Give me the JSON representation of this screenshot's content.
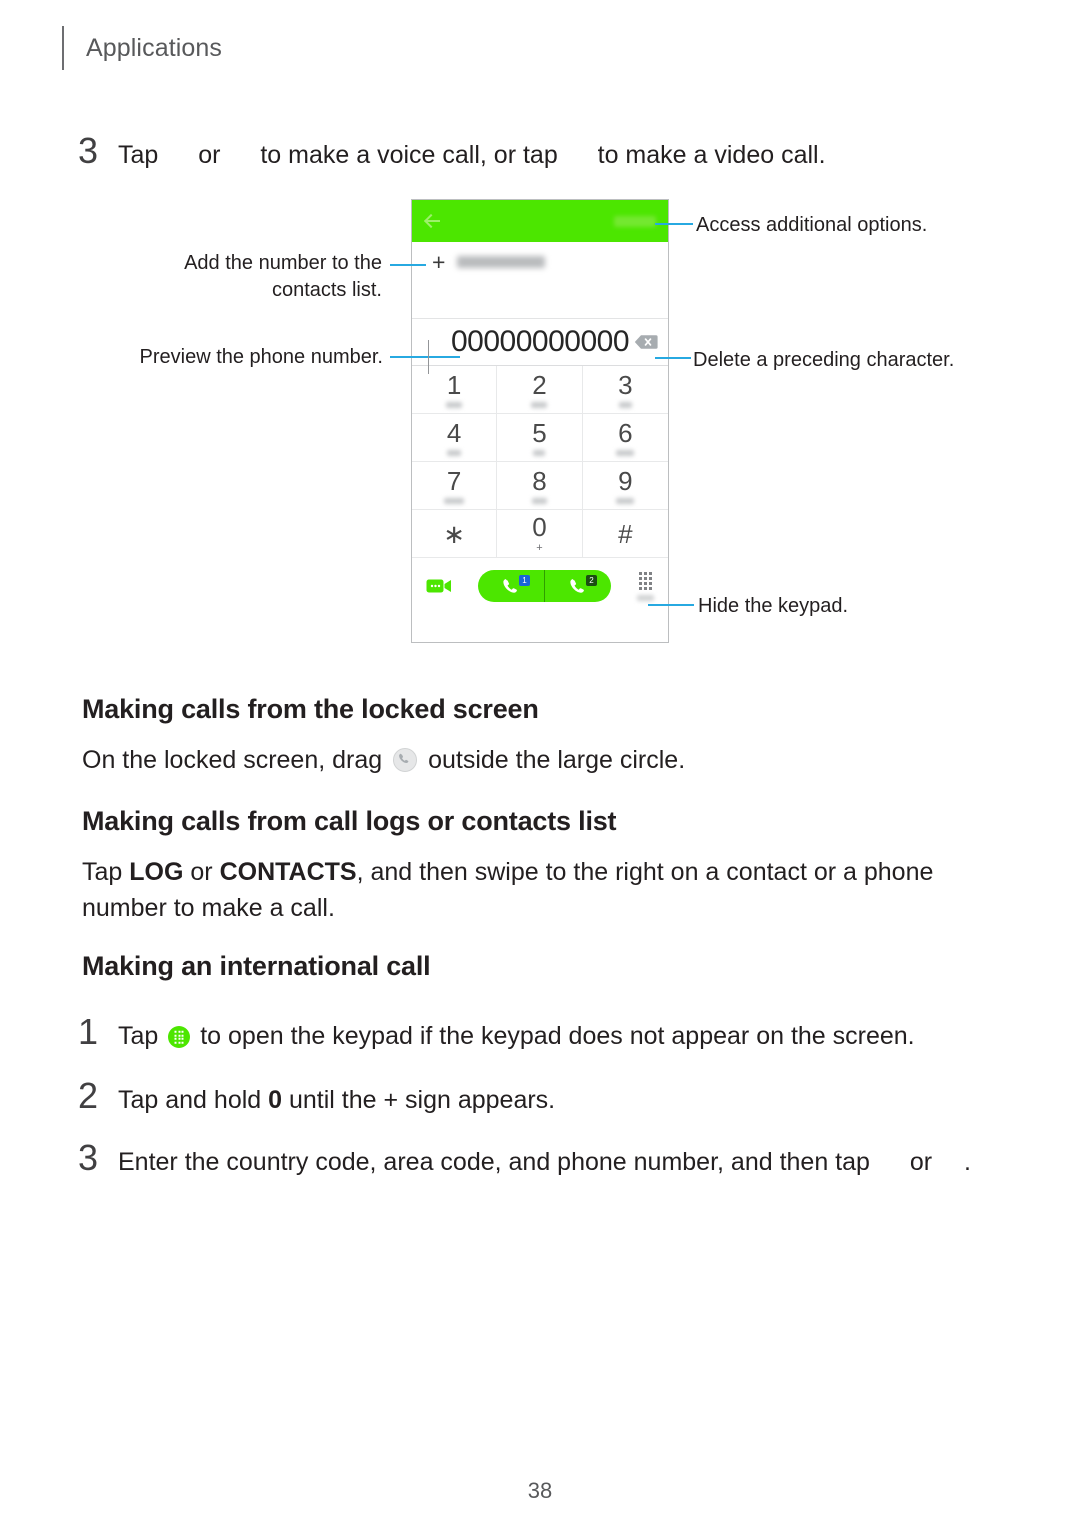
{
  "header": {
    "title": "Applications"
  },
  "steps": {
    "top": {
      "number": "3",
      "before_icons": "Tap",
      "between": "or",
      "after_first": "to make a voice call, or tap",
      "tail": "to make a video call."
    },
    "intl_1": {
      "number": "1",
      "pre": "Tap",
      "post": "to open the keypad if the keypad does not appear on the screen."
    },
    "intl_2": {
      "number": "2",
      "text_a": "Tap and hold ",
      "bold": "0",
      "text_b": " until the + sign appears."
    },
    "intl_3": {
      "number": "3",
      "pre": "Enter the country code, area code, and phone number, and then tap",
      "mid": "or",
      "post": "."
    }
  },
  "phone": {
    "topbar": {
      "back_icon": "back-arrow-icon",
      "more_label": ""
    },
    "add_contact": {
      "plus": "+",
      "label": ""
    },
    "number_preview": "00000000000",
    "keypad": [
      {
        "digit": "1",
        "sub": "",
        "sub_width": 16
      },
      {
        "digit": "2",
        "sub": "",
        "sub_width": 16
      },
      {
        "digit": "3",
        "sub": "",
        "sub_width": 13
      },
      {
        "digit": "4",
        "sub": "",
        "sub_width": 14
      },
      {
        "digit": "5",
        "sub": "",
        "sub_width": 12
      },
      {
        "digit": "6",
        "sub": "",
        "sub_width": 18
      },
      {
        "digit": "7",
        "sub": "",
        "sub_width": 20
      },
      {
        "digit": "8",
        "sub": "",
        "sub_width": 15
      },
      {
        "digit": "9",
        "sub": "",
        "sub_width": 18
      },
      {
        "digit": "∗",
        "sub": "",
        "sub_width": 0
      },
      {
        "digit": "0",
        "sub": "+",
        "sub_width": 0
      },
      {
        "digit": "#",
        "sub": "",
        "sub_width": 0
      }
    ],
    "actions": {
      "video_icon": "video-call-icon",
      "call_sim1_badge": "1",
      "call_sim2_badge": "2",
      "keypad_toggle_icon": "keypad-icon"
    }
  },
  "callouts": {
    "add_to_contacts": "Add the number to the contacts list.",
    "preview_number": "Preview the phone number.",
    "access_options": "Access additional options.",
    "delete_char": "Delete a preceding character.",
    "hide_keypad": "Hide the keypad."
  },
  "sections": {
    "locked": {
      "heading": "Making calls from the locked screen",
      "body_a": "On the locked screen, drag",
      "body_b": "outside the large circle."
    },
    "logs": {
      "heading": "Making calls from call logs or contacts list",
      "body_a": "Tap ",
      "bold_log": "LOG",
      "body_b": " or ",
      "bold_contacts": "CONTACTS",
      "body_c": ", and then swipe to the right on a contact or a phone number to make a call."
    },
    "international": {
      "heading": "Making an international call"
    }
  },
  "footer": {
    "page_number": "38"
  },
  "colors": {
    "accent_green": "#4ce600",
    "leader_blue": "#27a9e1",
    "sim1_blue": "#1a64d8",
    "sim2_dark": "#1b4d12"
  }
}
